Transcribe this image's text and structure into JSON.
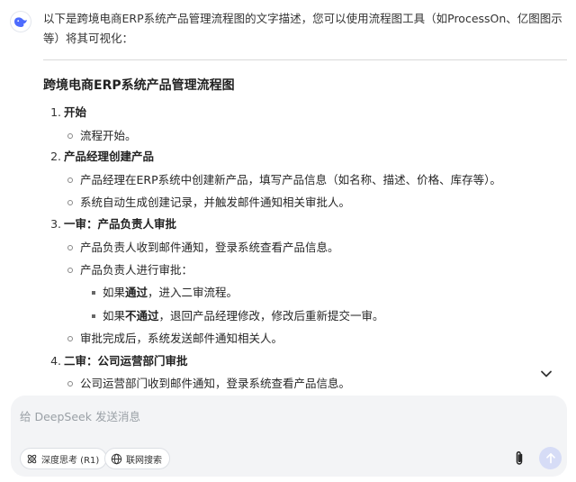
{
  "chat": {
    "intro": "以下是跨境电商ERP系统产品管理流程图的文字描述，您可以使用流程图工具（如ProcessOn、亿图图示等）将其可视化：",
    "title": "跨境电商ERP系统产品管理流程图",
    "steps": [
      {
        "num": "1.",
        "heading": "开始",
        "bullets": [
          "流程开始。"
        ]
      },
      {
        "num": "2.",
        "heading": "产品经理创建产品",
        "bullets": [
          "产品经理在ERP系统中创建新产品，填写产品信息（如名称、描述、价格、库存等）。",
          "系统自动生成创建记录，并触发邮件通知相关审批人。"
        ]
      },
      {
        "num": "3.",
        "heading": "一审：产品负责人审批",
        "bullets": [
          "产品负责人收到邮件通知，登录系统查看产品信息。",
          "产品负责人进行审批：",
          "审批完成后，系统发送邮件通知相关人。"
        ],
        "sub_bullets": [
          {
            "prefix": "如果",
            "bold": "通过",
            "suffix": "，进入二审流程。"
          },
          {
            "prefix": "如果",
            "bold": "不通过",
            "suffix": "，退回产品经理修改，修改后重新提交一审。"
          }
        ]
      },
      {
        "num": "4.",
        "heading": "二审：公司运营部门审批",
        "bullets": [
          "公司运营部门收到邮件通知，登录系统查看产品信息。"
        ]
      }
    ]
  },
  "composer": {
    "placeholder": "给 DeepSeek 发送消息",
    "deep_think_label": "深度思考 (R1)",
    "web_search_label": "联网搜索"
  },
  "icons": {
    "assistant_avatar": "deepseek-whale-icon",
    "scroll_down": "chevron-down-icon",
    "attach": "paperclip-icon",
    "send": "arrow-up-icon"
  },
  "colors": {
    "brand": "#4d6bfe",
    "send_disabled": "#d6dcf6"
  }
}
